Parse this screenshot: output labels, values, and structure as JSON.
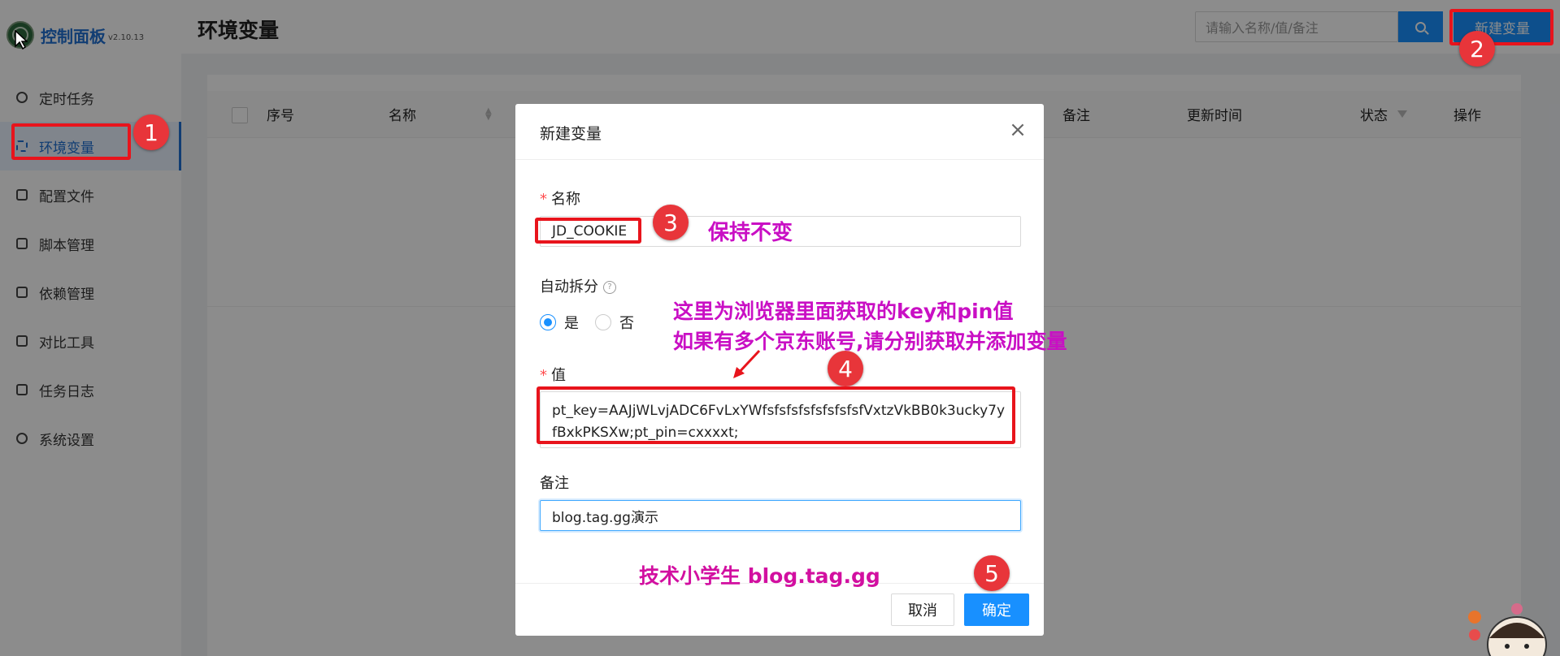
{
  "app": {
    "logo_text": "控制面板",
    "version": "v2.10.13",
    "page_title": "环境变量"
  },
  "sidebar": {
    "items": [
      {
        "label": "定时任务",
        "icon": "clock-icon"
      },
      {
        "label": "环境变量",
        "icon": "env-icon",
        "active": true
      },
      {
        "label": "配置文件",
        "icon": "sliders-icon"
      },
      {
        "label": "脚本管理",
        "icon": "edit-icon"
      },
      {
        "label": "依赖管理",
        "icon": "package-icon"
      },
      {
        "label": "对比工具",
        "icon": "diff-icon"
      },
      {
        "label": "任务日志",
        "icon": "folder-icon"
      },
      {
        "label": "系统设置",
        "icon": "gear-icon"
      }
    ]
  },
  "header": {
    "search_placeholder": "请输入名称/值/备注",
    "new_button": "新建变量"
  },
  "table": {
    "columns": [
      "序号",
      "名称",
      "备注",
      "更新时间",
      "状态",
      "操作"
    ]
  },
  "modal": {
    "title": "新建变量",
    "name_label": "名称",
    "name_value": "JD_COOKIE",
    "auto_split_label": "自动拆分",
    "radio_yes": "是",
    "radio_no": "否",
    "value_label": "值",
    "value_text": "pt_key=AAJjWLvjADC6FvLxYWfsfsfsfsfsfsfsfsfVxtzVkBB0k3ucky7yfBxkPKSXw;pt_pin=cxxxxt;",
    "remark_label": "备注",
    "remark_value": "blog.tag.gg演示",
    "cancel": "取消",
    "confirm": "确定"
  },
  "annotations": {
    "badges": [
      "1",
      "2",
      "3",
      "4",
      "5"
    ],
    "keep_unchanged": "保持不变",
    "hint_line1": "这里为浏览器里面获取的key和pin值",
    "hint_line2": "如果有多个京东账号,请分别获取并添加变量",
    "watermark": "技术小学生 blog.tag.gg"
  },
  "colors": {
    "primary": "#1890ff",
    "annotation_red": "#e8141c",
    "annotation_purple": "#c90fc4"
  }
}
